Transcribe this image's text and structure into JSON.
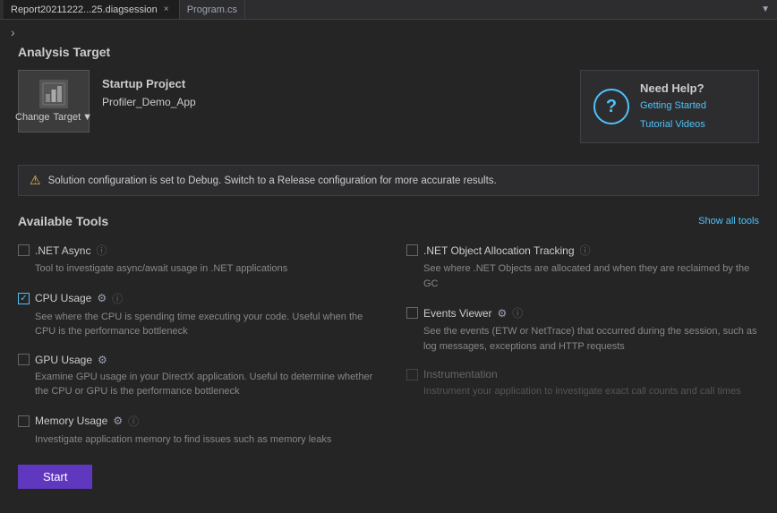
{
  "titlebar": {
    "tabs": [
      {
        "label": "Report20211222...25.diagsession",
        "active": true,
        "closeable": true
      },
      {
        "label": "Program.cs",
        "active": false,
        "closeable": false
      }
    ],
    "arrow": "▼"
  },
  "chevron": "›",
  "analysis_target": {
    "section_title": "Analysis Target",
    "change_target_label": "Change",
    "change_target_sublabel": "Target",
    "dropdown_arrow": "▼",
    "startup_project_label": "Startup Project",
    "project_name": "Profiler_Demo_App"
  },
  "need_help": {
    "title": "Need Help?",
    "link1": "Getting Started",
    "link2": "Tutorial Videos",
    "icon": "?"
  },
  "warning": {
    "text": "Solution configuration is set to Debug. Switch to a Release configuration for more accurate results."
  },
  "available_tools": {
    "section_title": "Available Tools",
    "show_all_label": "Show all tools",
    "tools": [
      {
        "id": "dotnet-async",
        "name": ".NET Async",
        "checked": false,
        "disabled": false,
        "has_info": true,
        "has_gear": false,
        "description": "Tool to investigate async/await usage in .NET applications"
      },
      {
        "id": "dotnet-object-allocation",
        "name": ".NET Object Allocation Tracking",
        "checked": false,
        "disabled": false,
        "has_info": true,
        "has_gear": false,
        "description": "See where .NET Objects are allocated and when they are reclaimed by the GC"
      },
      {
        "id": "cpu-usage",
        "name": "CPU Usage",
        "checked": true,
        "disabled": false,
        "has_info": true,
        "has_gear": true,
        "description": "See where the CPU is spending time executing your code. Useful when the CPU is the performance bottleneck"
      },
      {
        "id": "events-viewer",
        "name": "Events Viewer",
        "checked": false,
        "disabled": false,
        "has_info": true,
        "has_gear": true,
        "description": "See the events (ETW or NetTrace) that occurred during the session, such as log messages, exceptions and HTTP requests"
      },
      {
        "id": "gpu-usage",
        "name": "GPU Usage",
        "checked": false,
        "disabled": false,
        "has_info": false,
        "has_gear": true,
        "description": "Examine GPU usage in your DirectX application. Useful to determine whether the CPU or GPU is the performance bottleneck"
      },
      {
        "id": "instrumentation",
        "name": "Instrumentation",
        "checked": false,
        "disabled": true,
        "has_info": false,
        "has_gear": false,
        "description": "Instrument your application to investigate exact call counts and call times"
      },
      {
        "id": "memory-usage",
        "name": "Memory Usage",
        "checked": false,
        "disabled": false,
        "has_info": true,
        "has_gear": true,
        "description": "Investigate application memory to find issues such as memory leaks"
      }
    ]
  },
  "start_button": "Start",
  "colors": {
    "accent": "#4fc3f7",
    "brand": "#6038c0",
    "warning": "#f0c040",
    "checked": "#4fc3f7"
  }
}
